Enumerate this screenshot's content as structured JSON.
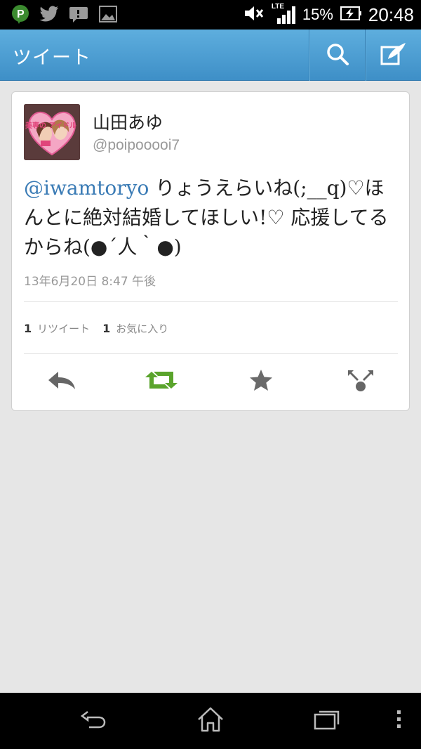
{
  "status_bar": {
    "icons_left": [
      "pinterest-icon",
      "twitter-bird-icon",
      "message-icon",
      "image-icon"
    ],
    "icons_right": [
      "mute-icon",
      "lte-signal-icon",
      "battery-charging-icon"
    ],
    "network": "LTE",
    "battery_percent": "15%",
    "time": "20:48"
  },
  "action_bar": {
    "title": "ツイート",
    "buttons": [
      "search-icon",
      "compose-icon"
    ]
  },
  "tweet": {
    "display_name": "山田あゆ",
    "handle": "@poipooooi7",
    "mention": "@iwamtoryo",
    "text": " りょうえらいね(;__q)♡ほんとに絶対結婚してほしい!♡ 応援してるからね(●´人｀●)",
    "timestamp": "13年6月20日 8:47 午後",
    "retweet_count": "1",
    "retweet_label": "リツイート",
    "favorite_count": "1",
    "favorite_label": "お気に入り",
    "avatar_text": "美専の アイドル"
  },
  "colors": {
    "action_bar": "#4a9ad3",
    "mention": "#3a7bb5",
    "retweet_green": "#5aa42c",
    "background": "#e6e6e6"
  },
  "nav_bar": {
    "buttons": [
      "back-icon",
      "home-icon",
      "recent-apps-icon",
      "menu-icon"
    ]
  }
}
